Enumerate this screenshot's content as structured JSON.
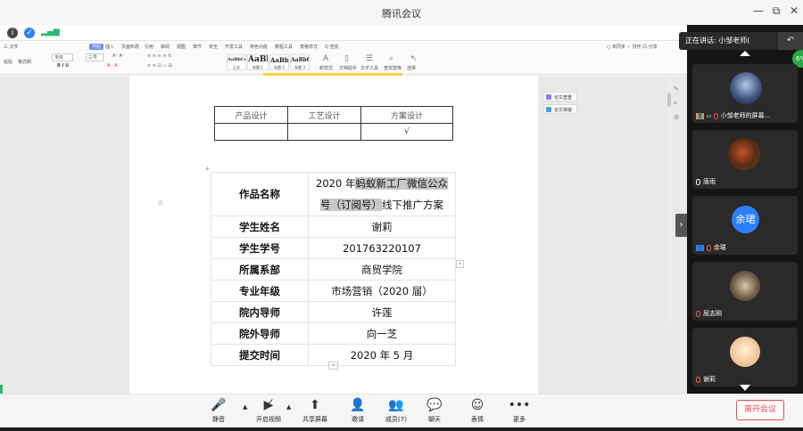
{
  "app": {
    "title": "腾讯会议"
  },
  "window_controls": {
    "minimize": "—",
    "restore": "⧉",
    "close": "✕"
  },
  "ribbon": {
    "menu": [
      "三 文件",
      "开始",
      "插入",
      "页面布局",
      "引用",
      "审阅",
      "视图",
      "章节",
      "安全",
      "开发工具",
      "特色功能",
      "教程工具",
      "表格样式",
      "Q 查找"
    ],
    "active_menu": "开始",
    "right_info": "○ 未同步  ☆ 协作  凸 分享",
    "row2": [
      "粘贴",
      "格式刷",
      "宋体",
      "三号",
      "A⁺ A⁻",
      "B I U",
      "A · A"
    ],
    "styles": [
      {
        "text": "AaBbCcDd",
        "name": "正文"
      },
      {
        "text": "AaBb",
        "name": "标题 1"
      },
      {
        "text": "AaBb(",
        "name": "标题 2"
      },
      {
        "text": "AaBbC",
        "name": "标题 3"
      }
    ],
    "tools": [
      "新样式",
      "文档助手",
      "文字工具",
      "查找替换",
      "选择"
    ]
  },
  "doc": {
    "table1": {
      "headers": [
        "产品设计",
        "工艺设计",
        "方案设计"
      ],
      "row": [
        "",
        "",
        "√"
      ]
    },
    "table2": {
      "rows": [
        {
          "label": "作品名称",
          "value_line1_a": "2020 年",
          "value_line1_b": "蚂蚁新工厂微信公众",
          "value_line2_a": "号（订阅号）",
          "value_line2_b": "线下推广方案"
        },
        {
          "label": "学生姓名",
          "value": "谢莉"
        },
        {
          "label": "学生学号",
          "value": "201763220107"
        },
        {
          "label": "所属系部",
          "value": "商贸学院"
        },
        {
          "label": "专业年级",
          "value": "市场营销（2020 届）"
        },
        {
          "label": "院内导师",
          "value": "许莲"
        },
        {
          "label": "院外导师",
          "value": "向一芝"
        },
        {
          "label": "提交时间",
          "value": "2020 年 5 月"
        }
      ]
    },
    "side_buttons": [
      "论文查重",
      "论文排版"
    ]
  },
  "meeting": {
    "speaking_prefix": "正在讲话: ",
    "speaking_name": "小邹老师",
    "speaking_suffix": "(",
    "percent": "6%",
    "participants": [
      {
        "name": "小邹老师的屏幕..."
      },
      {
        "name": "唐雨"
      },
      {
        "name": "余珺",
        "avatar": "余珺"
      },
      {
        "name": "屈志刚"
      },
      {
        "name": "谢莉"
      }
    ]
  },
  "toolbar": {
    "mute": "静音",
    "video": "开启视频",
    "share": "共享屏幕",
    "invite": "邀请",
    "members": "成员(7)",
    "chat": "聊天",
    "emoji": "表情",
    "more": "更多",
    "leave": "离开会议"
  },
  "colors": {
    "accent": "#2d7ff9",
    "leave": "#e84a4a",
    "ribbon_active": "#6d8ef2"
  }
}
